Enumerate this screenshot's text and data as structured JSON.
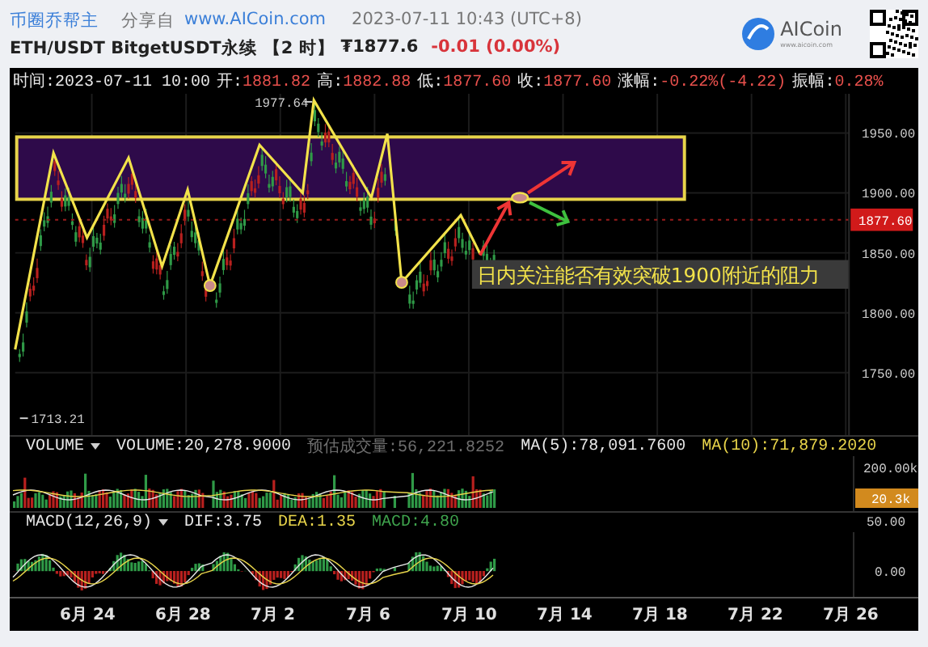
{
  "header": {
    "author": "币圈乔帮主",
    "share_prefix": "分享自",
    "share_link": "www.AICoin.com",
    "timestamp": "2023-07-11 10:43 (UTC+8)",
    "pair": "ETH/USDT BitgetUSDT永续",
    "interval": "【2 时】",
    "price": "₮1877.6",
    "change": "-0.01 (0.00%)",
    "logo": "AICoin",
    "logo_sub": "www.aicoin.com"
  },
  "info_bar": [
    {
      "label": "时间:",
      "value": "2023-07-11 10:00",
      "color": "#e8e8e8"
    },
    {
      "label": "开:",
      "value": "1881.82",
      "color": "#e8504c"
    },
    {
      "label": "高:",
      "value": "1882.88",
      "color": "#e8504c"
    },
    {
      "label": "低:",
      "value": "1877.60",
      "color": "#e8504c"
    },
    {
      "label": "收:",
      "value": "1877.60",
      "color": "#e8504c"
    },
    {
      "label": "涨幅:",
      "value": "-0.22%(-4.22)",
      "color": "#e8504c"
    },
    {
      "label": "振幅:",
      "value": "0.28%",
      "color": "#e8504c"
    }
  ],
  "price_chart": {
    "yticks": [
      "1950.00",
      "1900.00",
      "1850.00",
      "1800.00",
      "1750.00"
    ],
    "current_price": "1877.60",
    "high_label": "1977.64",
    "low_label": "1713.21",
    "annotation": "日内关注能否有效突破1900附近的阻力"
  },
  "volume": {
    "title": "VOLUME",
    "legend": [
      {
        "text": "VOLUME:20,278.9000",
        "color": "#e8e8e8"
      },
      {
        "text": "预估成交量:56,221.8252",
        "color": "#6e6e6e"
      },
      {
        "text": "MA(5):78,091.7600",
        "color": "#e8e8e8"
      },
      {
        "text": "MA(10):71,879.2020",
        "color": "#e8d44a"
      }
    ],
    "axis_label": "200.00k",
    "current": "20.3k"
  },
  "macd": {
    "title": "MACD(12,26,9)",
    "legend": [
      {
        "text": "DIF:3.75",
        "color": "#e8e8e8"
      },
      {
        "text": "DEA:1.35",
        "color": "#e8d44a"
      },
      {
        "text": "MACD:4.80",
        "color": "#3fa34d"
      }
    ],
    "axis_labels": [
      "50.00",
      "0.00"
    ]
  },
  "dates": [
    "6月 24",
    "6月 28",
    "7月 2",
    "7月 6",
    "7月 10",
    "7月 14",
    "7月 18",
    "7月 22",
    "7月 26"
  ]
}
